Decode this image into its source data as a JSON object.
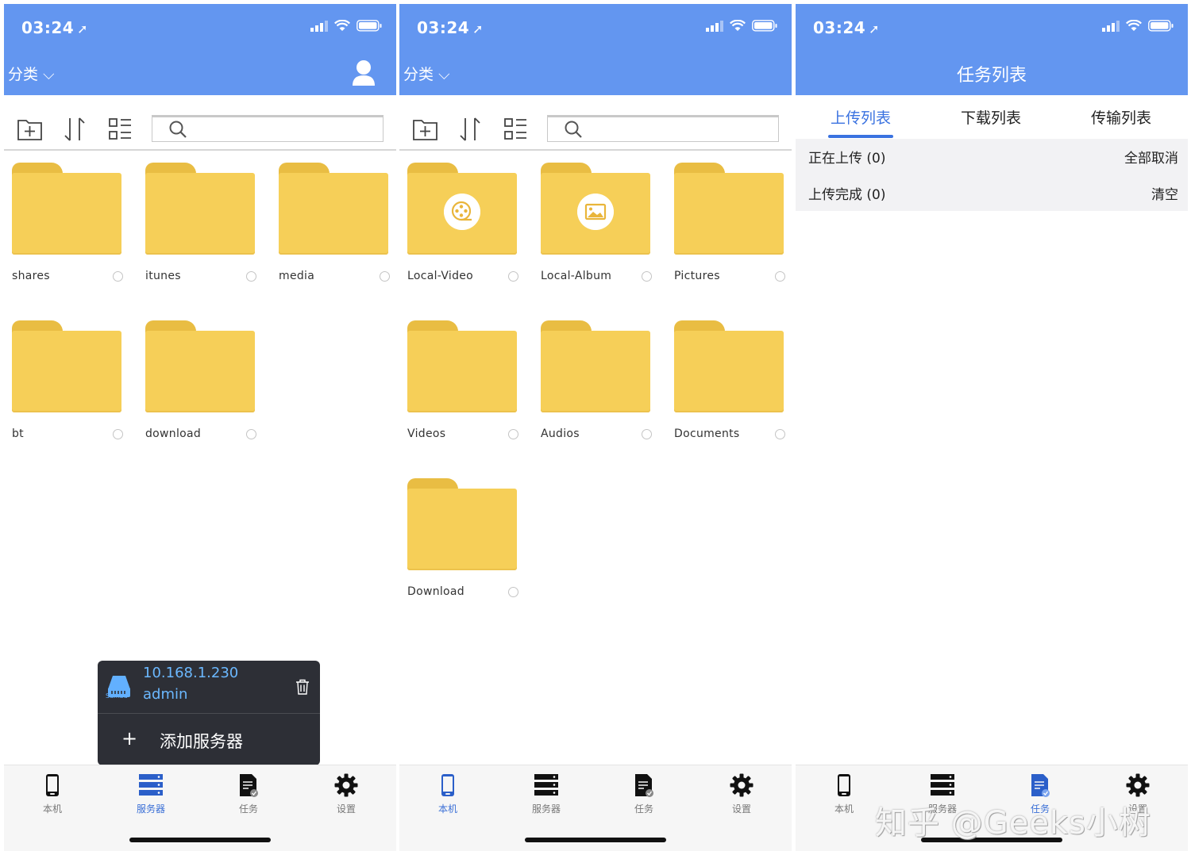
{
  "status_bar": {
    "time": "03:24"
  },
  "colors": {
    "header": "#6396f0",
    "folder": "#f6cf58",
    "accent": "#3a72e0",
    "popup": "#2d2f36"
  },
  "screen1": {
    "category": "分类",
    "folders": [
      "shares",
      "itunes",
      "media",
      "bt",
      "download"
    ],
    "popup": {
      "icon_label": "Samba",
      "ip": "10.168.1.230",
      "user": "admin",
      "add_server": "添加服务器"
    }
  },
  "screen2": {
    "category": "分类",
    "folders": [
      "Local-Video",
      "Local-Album",
      "Pictures",
      "Videos",
      "Audios",
      "Documents",
      "Download"
    ]
  },
  "screen3": {
    "title": "任务列表",
    "tabs": [
      "上传列表",
      "下载列表",
      "传输列表"
    ],
    "rows": [
      {
        "label": "正在上传 (0)",
        "action": "全部取消"
      },
      {
        "label": "上传完成 (0)",
        "action": "清空"
      }
    ]
  },
  "tabbar": {
    "local": "本机",
    "server": "服务器",
    "tasks": "任务",
    "settings": "设置"
  },
  "watermark": "知乎 @Geeks小树"
}
